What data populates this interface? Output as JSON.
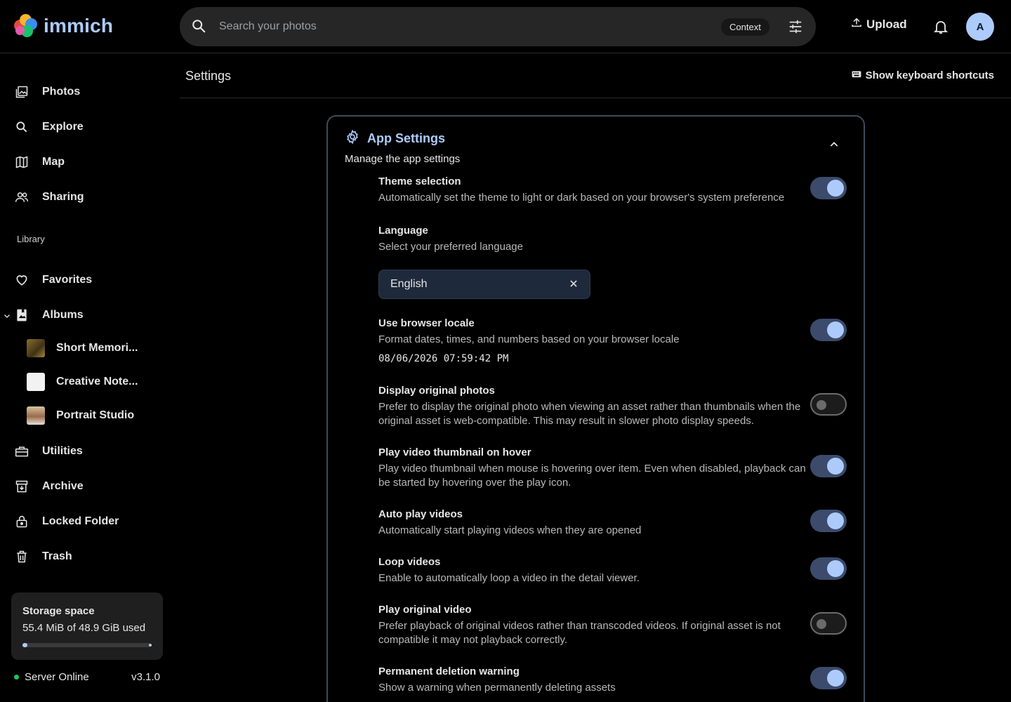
{
  "app": {
    "name": "immich"
  },
  "search": {
    "placeholder": "Search your photos",
    "context_label": "Context"
  },
  "header": {
    "upload_label": "Upload",
    "avatar_initial": "A"
  },
  "sidebar": {
    "items": [
      {
        "label": "Photos",
        "icon": "photos-icon"
      },
      {
        "label": "Explore",
        "icon": "search-icon"
      },
      {
        "label": "Map",
        "icon": "map-icon"
      },
      {
        "label": "Sharing",
        "icon": "people-icon"
      }
    ],
    "library_label": "Library",
    "library_items": [
      {
        "label": "Favorites",
        "icon": "heart-icon"
      },
      {
        "label": "Albums",
        "icon": "album-icon"
      }
    ],
    "albums": [
      {
        "label": "Short Memori...",
        "thumb_color": "#6b5a2a"
      },
      {
        "label": "Creative Note...",
        "thumb_color": "#f2f2f2"
      },
      {
        "label": "Portrait Studio",
        "thumb_color": "#c9a98a"
      }
    ],
    "bottom_items": [
      {
        "label": "Utilities",
        "icon": "toolbox-icon"
      },
      {
        "label": "Archive",
        "icon": "archive-icon"
      },
      {
        "label": "Locked Folder",
        "icon": "lock-icon"
      },
      {
        "label": "Trash",
        "icon": "trash-icon"
      }
    ],
    "storage": {
      "title": "Storage space",
      "used_text": "55.4 MiB of 48.9 GiB used",
      "used_fraction": 0.0011
    },
    "server": {
      "status": "Server Online",
      "version": "v3.1.0"
    }
  },
  "page": {
    "title": "Settings",
    "shortcuts_label": "Show keyboard shortcuts"
  },
  "card": {
    "title": "App Settings",
    "subtitle": "Manage the app settings",
    "settings": [
      {
        "title": "Theme selection",
        "desc": "Automatically set the theme to light or dark based on your browser's system preference",
        "on": true
      },
      {
        "title": "Language",
        "desc": "Select your preferred language",
        "selected": "English"
      },
      {
        "title": "Use browser locale",
        "desc": "Format dates, times, and numbers based on your browser locale",
        "sample": "08/06/2026 07:59:42 PM",
        "on": true
      },
      {
        "title": "Display original photos",
        "desc": "Prefer to display the original photo when viewing an asset rather than thumbnails when the original asset is web-compatible. This may result in slower photo display speeds.",
        "on": false
      },
      {
        "title": "Play video thumbnail on hover",
        "desc": "Play video thumbnail when mouse is hovering over item. Even when disabled, playback can be started by hovering over the play icon.",
        "on": true
      },
      {
        "title": "Auto play videos",
        "desc": "Automatically start playing videos when they are opened",
        "on": true
      },
      {
        "title": "Loop videos",
        "desc": "Enable to automatically loop a video in the detail viewer.",
        "on": true
      },
      {
        "title": "Play original video",
        "desc": "Prefer playback of original videos rather than transcoded videos. If original asset is not compatible it may not playback correctly.",
        "on": false
      },
      {
        "title": "Permanent deletion warning",
        "desc": "Show a warning when permanently deleting assets",
        "on": true
      }
    ]
  },
  "colors": {
    "accent": "#adcbfa",
    "background": "#000000",
    "online": "#22c55e"
  }
}
